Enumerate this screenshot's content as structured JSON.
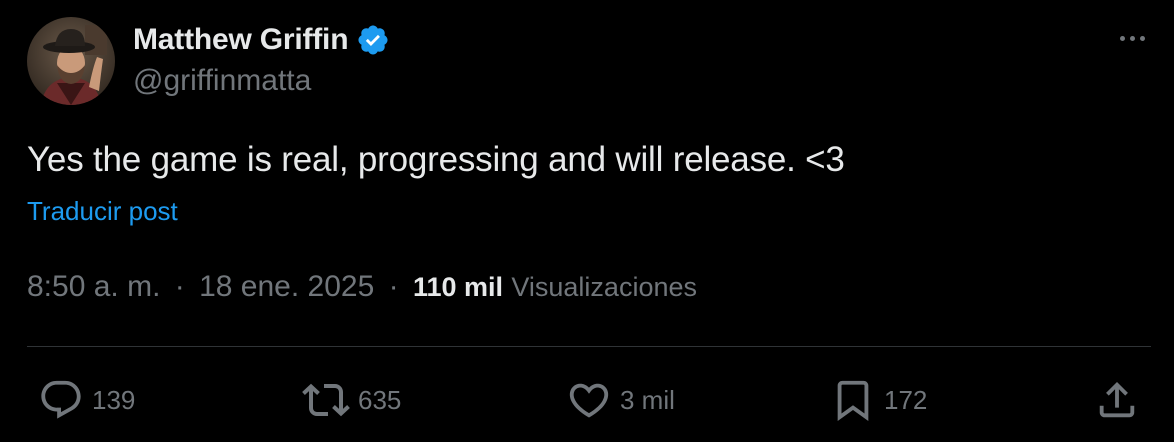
{
  "author": {
    "display_name": "Matthew Griffin",
    "handle": "@griffinmatta",
    "verified_icon": "verified-badge-icon",
    "verified_color": "#1d9bf0"
  },
  "post": {
    "text": "Yes the game is real, progressing and will release. <3",
    "translate_label": "Traducir post",
    "time": "8:50 a. m.",
    "date": "18 ene. 2025",
    "separator": "·",
    "views_count": "110 mil",
    "views_label": "Visualizaciones"
  },
  "actions": {
    "replies": "139",
    "reposts": "635",
    "likes": "3 mil",
    "bookmarks": "172"
  },
  "colors": {
    "background": "#000000",
    "text_primary": "#e7e9ea",
    "text_secondary": "#71767b",
    "accent": "#1d9bf0",
    "divider": "#2f3336"
  }
}
